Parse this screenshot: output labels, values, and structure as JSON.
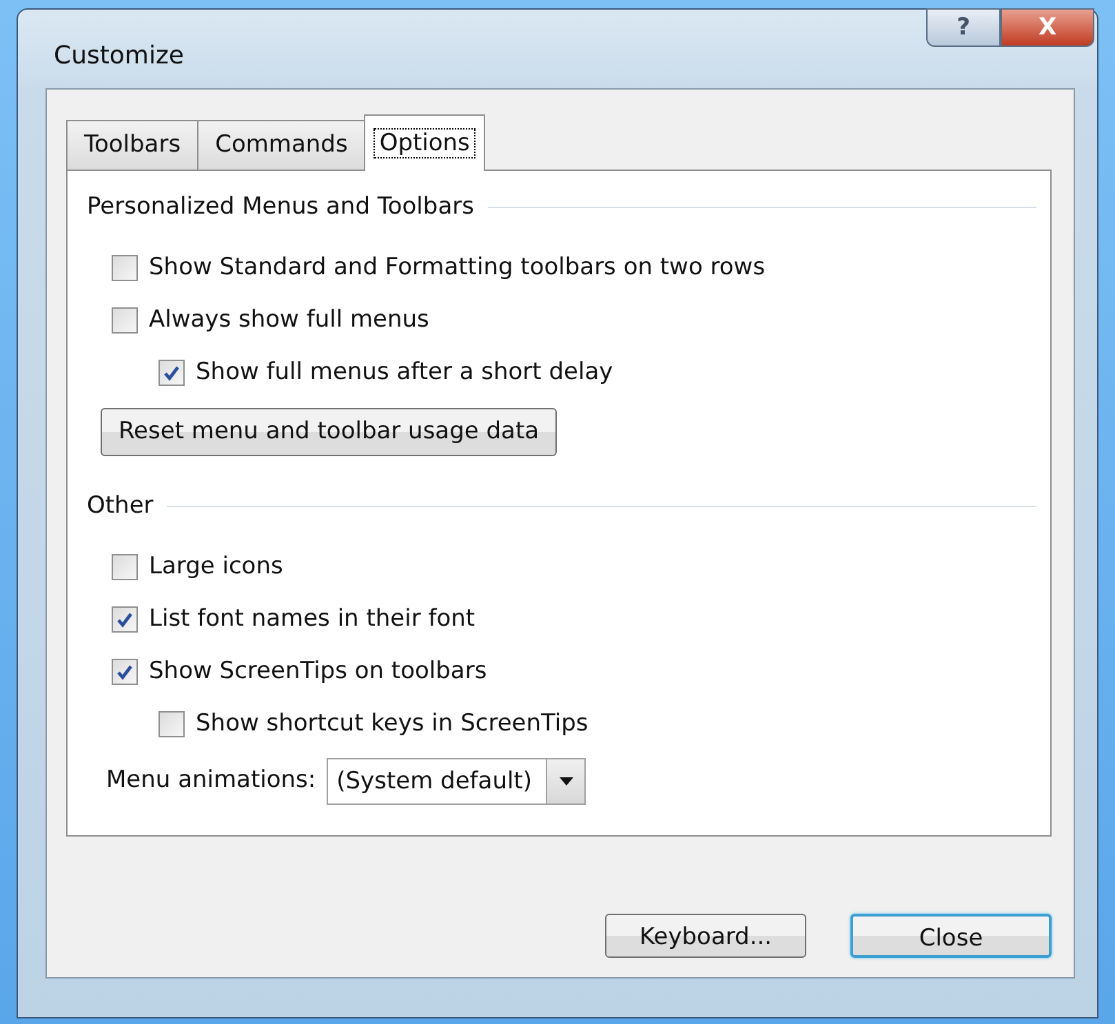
{
  "window": {
    "title": "Customize",
    "controls": [
      "?",
      "X"
    ]
  },
  "tabs": [
    {
      "label": "Toolbars",
      "selected": false
    },
    {
      "label": "Commands",
      "selected": false
    },
    {
      "label": "Options",
      "selected": true
    }
  ],
  "groups": [
    {
      "title": "Personalized Menus and Toolbars",
      "items": [
        {
          "kind": "checkbox",
          "label": "Show Standard and Formatting toolbars on two rows",
          "checked": false
        },
        {
          "kind": "checkbox",
          "label": "Always show full menus",
          "checked": false,
          "children": [
            {
              "kind": "checkbox",
              "label": "Show full menus after a short delay",
              "checked": true
            }
          ]
        },
        {
          "kind": "button",
          "label": "Reset menu and toolbar usage data"
        }
      ]
    },
    {
      "title": "Other",
      "items": [
        {
          "kind": "checkbox",
          "label": "Large icons",
          "checked": false
        },
        {
          "kind": "checkbox",
          "label": "List font names in their font",
          "checked": true
        },
        {
          "kind": "checkbox",
          "label": "Show ScreenTips on toolbars",
          "checked": true,
          "children": [
            {
              "kind": "checkbox",
              "label": "Show shortcut keys in ScreenTips",
              "checked": false
            }
          ]
        },
        {
          "kind": "dropdown",
          "label": "Menu animations:",
          "value": "(System default)"
        }
      ]
    }
  ],
  "buttons": [
    {
      "label": "Keyboard...",
      "default": false
    },
    {
      "label": "Close",
      "default": true
    }
  ]
}
